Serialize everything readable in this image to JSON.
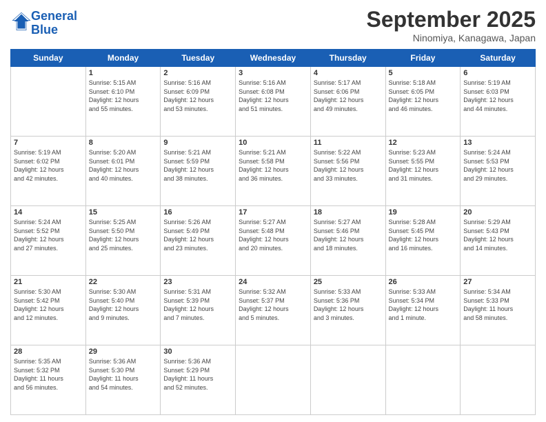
{
  "header": {
    "logo_line1": "General",
    "logo_line2": "Blue",
    "title": "September 2025",
    "subtitle": "Ninomiya, Kanagawa, Japan"
  },
  "days_of_week": [
    "Sunday",
    "Monday",
    "Tuesday",
    "Wednesday",
    "Thursday",
    "Friday",
    "Saturday"
  ],
  "weeks": [
    [
      {
        "day": "",
        "info": ""
      },
      {
        "day": "1",
        "info": "Sunrise: 5:15 AM\nSunset: 6:10 PM\nDaylight: 12 hours\nand 55 minutes."
      },
      {
        "day": "2",
        "info": "Sunrise: 5:16 AM\nSunset: 6:09 PM\nDaylight: 12 hours\nand 53 minutes."
      },
      {
        "day": "3",
        "info": "Sunrise: 5:16 AM\nSunset: 6:08 PM\nDaylight: 12 hours\nand 51 minutes."
      },
      {
        "day": "4",
        "info": "Sunrise: 5:17 AM\nSunset: 6:06 PM\nDaylight: 12 hours\nand 49 minutes."
      },
      {
        "day": "5",
        "info": "Sunrise: 5:18 AM\nSunset: 6:05 PM\nDaylight: 12 hours\nand 46 minutes."
      },
      {
        "day": "6",
        "info": "Sunrise: 5:19 AM\nSunset: 6:03 PM\nDaylight: 12 hours\nand 44 minutes."
      }
    ],
    [
      {
        "day": "7",
        "info": "Sunrise: 5:19 AM\nSunset: 6:02 PM\nDaylight: 12 hours\nand 42 minutes."
      },
      {
        "day": "8",
        "info": "Sunrise: 5:20 AM\nSunset: 6:01 PM\nDaylight: 12 hours\nand 40 minutes."
      },
      {
        "day": "9",
        "info": "Sunrise: 5:21 AM\nSunset: 5:59 PM\nDaylight: 12 hours\nand 38 minutes."
      },
      {
        "day": "10",
        "info": "Sunrise: 5:21 AM\nSunset: 5:58 PM\nDaylight: 12 hours\nand 36 minutes."
      },
      {
        "day": "11",
        "info": "Sunrise: 5:22 AM\nSunset: 5:56 PM\nDaylight: 12 hours\nand 33 minutes."
      },
      {
        "day": "12",
        "info": "Sunrise: 5:23 AM\nSunset: 5:55 PM\nDaylight: 12 hours\nand 31 minutes."
      },
      {
        "day": "13",
        "info": "Sunrise: 5:24 AM\nSunset: 5:53 PM\nDaylight: 12 hours\nand 29 minutes."
      }
    ],
    [
      {
        "day": "14",
        "info": "Sunrise: 5:24 AM\nSunset: 5:52 PM\nDaylight: 12 hours\nand 27 minutes."
      },
      {
        "day": "15",
        "info": "Sunrise: 5:25 AM\nSunset: 5:50 PM\nDaylight: 12 hours\nand 25 minutes."
      },
      {
        "day": "16",
        "info": "Sunrise: 5:26 AM\nSunset: 5:49 PM\nDaylight: 12 hours\nand 23 minutes."
      },
      {
        "day": "17",
        "info": "Sunrise: 5:27 AM\nSunset: 5:48 PM\nDaylight: 12 hours\nand 20 minutes."
      },
      {
        "day": "18",
        "info": "Sunrise: 5:27 AM\nSunset: 5:46 PM\nDaylight: 12 hours\nand 18 minutes."
      },
      {
        "day": "19",
        "info": "Sunrise: 5:28 AM\nSunset: 5:45 PM\nDaylight: 12 hours\nand 16 minutes."
      },
      {
        "day": "20",
        "info": "Sunrise: 5:29 AM\nSunset: 5:43 PM\nDaylight: 12 hours\nand 14 minutes."
      }
    ],
    [
      {
        "day": "21",
        "info": "Sunrise: 5:30 AM\nSunset: 5:42 PM\nDaylight: 12 hours\nand 12 minutes."
      },
      {
        "day": "22",
        "info": "Sunrise: 5:30 AM\nSunset: 5:40 PM\nDaylight: 12 hours\nand 9 minutes."
      },
      {
        "day": "23",
        "info": "Sunrise: 5:31 AM\nSunset: 5:39 PM\nDaylight: 12 hours\nand 7 minutes."
      },
      {
        "day": "24",
        "info": "Sunrise: 5:32 AM\nSunset: 5:37 PM\nDaylight: 12 hours\nand 5 minutes."
      },
      {
        "day": "25",
        "info": "Sunrise: 5:33 AM\nSunset: 5:36 PM\nDaylight: 12 hours\nand 3 minutes."
      },
      {
        "day": "26",
        "info": "Sunrise: 5:33 AM\nSunset: 5:34 PM\nDaylight: 12 hours\nand 1 minute."
      },
      {
        "day": "27",
        "info": "Sunrise: 5:34 AM\nSunset: 5:33 PM\nDaylight: 11 hours\nand 58 minutes."
      }
    ],
    [
      {
        "day": "28",
        "info": "Sunrise: 5:35 AM\nSunset: 5:32 PM\nDaylight: 11 hours\nand 56 minutes."
      },
      {
        "day": "29",
        "info": "Sunrise: 5:36 AM\nSunset: 5:30 PM\nDaylight: 11 hours\nand 54 minutes."
      },
      {
        "day": "30",
        "info": "Sunrise: 5:36 AM\nSunset: 5:29 PM\nDaylight: 11 hours\nand 52 minutes."
      },
      {
        "day": "",
        "info": ""
      },
      {
        "day": "",
        "info": ""
      },
      {
        "day": "",
        "info": ""
      },
      {
        "day": "",
        "info": ""
      }
    ]
  ]
}
